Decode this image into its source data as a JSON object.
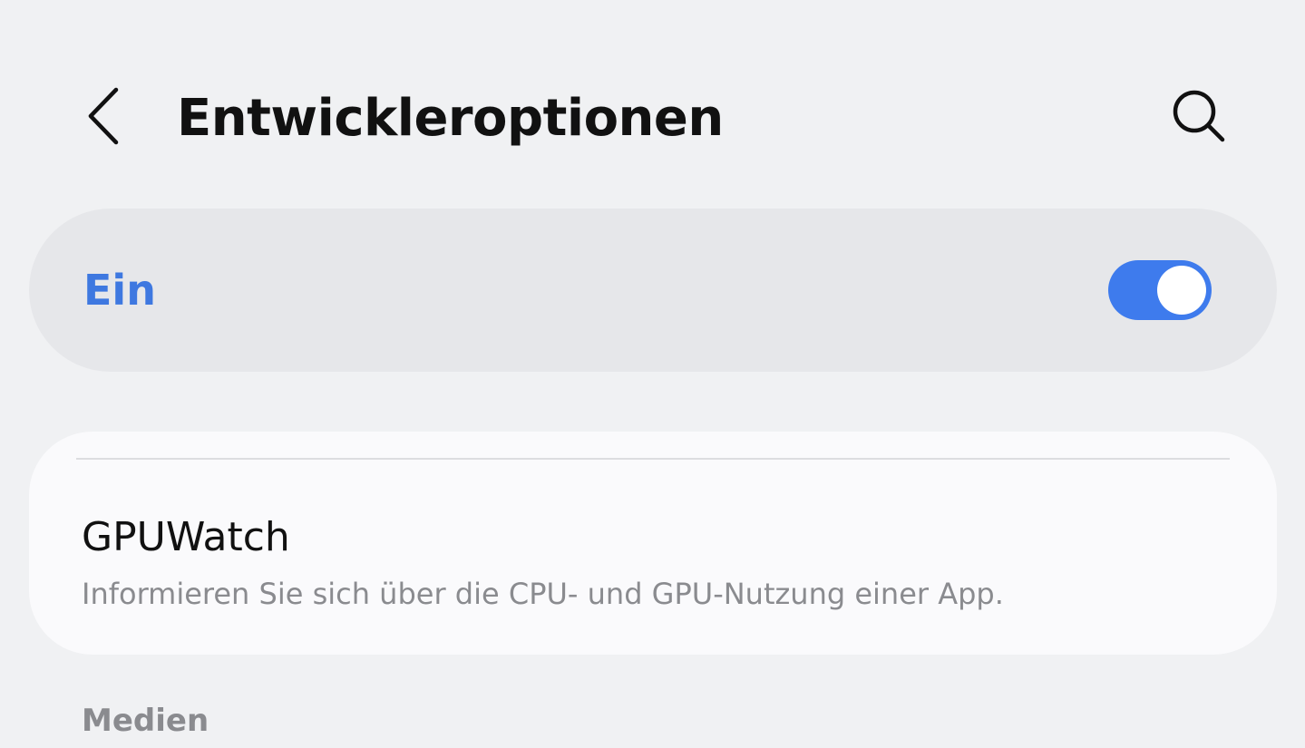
{
  "header": {
    "title": "Entwickleroptionen",
    "back_icon": "back-chevron-icon",
    "search_icon": "search-icon"
  },
  "master_switch": {
    "label": "Ein",
    "state": true,
    "accent_color": "#3e7bed"
  },
  "card": {
    "item": {
      "title": "GPUWatch",
      "summary": "Informieren Sie sich über die CPU- und GPU-Nutzung einer App."
    }
  },
  "section": {
    "header": "Medien"
  }
}
